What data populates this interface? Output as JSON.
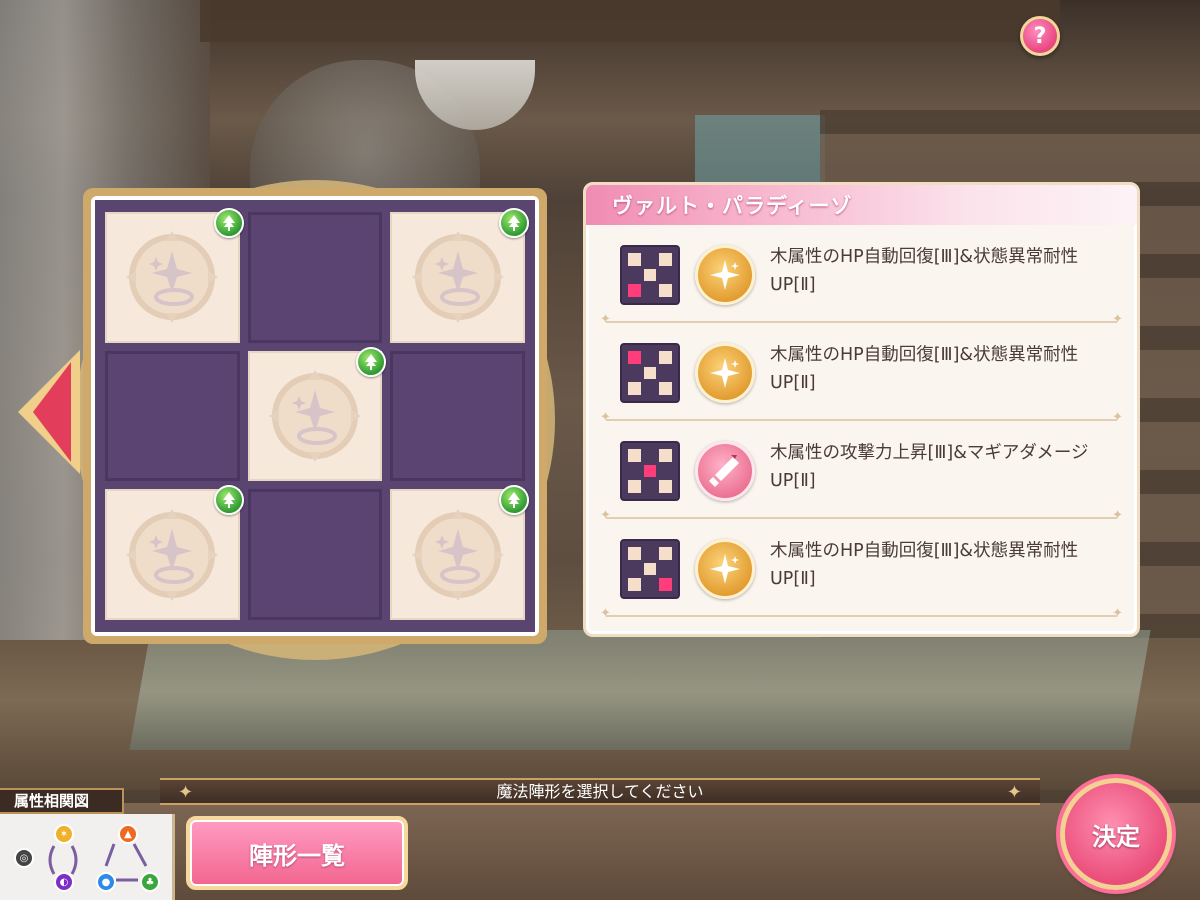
{
  "help_button": {
    "label": "?"
  },
  "formation": {
    "cells": [
      {
        "filled": true,
        "attribute": "wood"
      },
      {
        "filled": false
      },
      {
        "filled": true,
        "attribute": "wood"
      },
      {
        "filled": false
      },
      {
        "filled": true,
        "attribute": "wood"
      },
      {
        "filled": false
      },
      {
        "filled": true,
        "attribute": "wood"
      },
      {
        "filled": false
      },
      {
        "filled": true,
        "attribute": "wood"
      }
    ]
  },
  "panel": {
    "title": "ヴァルト・パラディーゾ",
    "skills": [
      {
        "text": "木属性のHP自動回復[Ⅲ]&状態異常耐性UP[Ⅱ]",
        "icon": "sparkle-icon",
        "highlight_cell": 6
      },
      {
        "text": "木属性のHP自動回復[Ⅲ]&状態異常耐性UP[Ⅱ]",
        "icon": "sparkle-icon",
        "highlight_cell": 0
      },
      {
        "text": "木属性の攻撃力上昇[Ⅲ]&マギアダメージUP[Ⅱ]",
        "icon": "sword-icon",
        "highlight_cell": 4
      },
      {
        "text": "木属性のHP自動回復[Ⅲ]&状態異常耐性UP[Ⅱ]",
        "icon": "sparkle-icon",
        "highlight_cell": 8
      }
    ]
  },
  "message": "魔法陣形を選択してください",
  "attribute_chart": {
    "label": "属性相関図"
  },
  "formation_list_button": {
    "label": "陣形一覧"
  },
  "confirm_button": {
    "label": "決定"
  },
  "colors": {
    "accent_pink": "#ea4e7a",
    "wood_green": "#2f9a33",
    "grid_purple": "#5a4470",
    "gold": "#cfa96a"
  }
}
